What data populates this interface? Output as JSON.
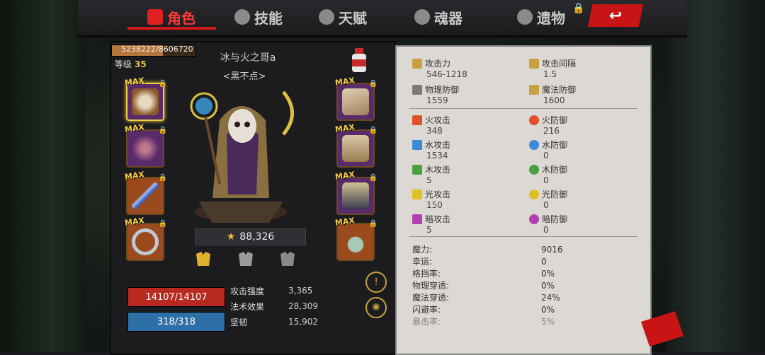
{
  "tabs": [
    {
      "label": "角色",
      "icon": "character-icon",
      "active": true
    },
    {
      "label": "技能",
      "icon": "skill-icon",
      "active": false
    },
    {
      "label": "天赋",
      "icon": "talent-icon",
      "active": false
    },
    {
      "label": "魂器",
      "icon": "soul-vessel-icon",
      "active": false
    },
    {
      "label": "遗物",
      "icon": "relic-icon",
      "active": false
    }
  ],
  "back_label": "↩",
  "exp": {
    "text": "5238222/8606720",
    "fraction": 0.61
  },
  "level": {
    "label": "等级",
    "value": "35"
  },
  "character": {
    "name": "冰与火之哥a",
    "title": "<黑不点>"
  },
  "power": {
    "value": "88,326"
  },
  "equipment": {
    "left": [
      {
        "name": "helmet",
        "max": "MAX",
        "color": "#5a2a6a"
      },
      {
        "name": "cloak",
        "max": "MAX",
        "color": "#5a2a6a"
      },
      {
        "name": "weapon",
        "max": "MAX",
        "color": "#9a4a1c"
      },
      {
        "name": "ring",
        "max": "MAX",
        "color": "#9a4a1c"
      }
    ],
    "right": [
      {
        "name": "shoulder",
        "max": "MAX",
        "color": "#5a2a6a"
      },
      {
        "name": "chest",
        "max": "MAX",
        "color": "#5a2a6a"
      },
      {
        "name": "boots",
        "max": "MAX",
        "color": "#5a2a6a"
      },
      {
        "name": "necklace",
        "max": "MAX",
        "color": "#9a4a1c"
      }
    ]
  },
  "hp": "14107/14107",
  "mp": "318/318",
  "sub_stats": [
    {
      "label": "攻击强度",
      "value": "3,365"
    },
    {
      "label": "法术效果",
      "value": "28,309"
    },
    {
      "label": "坚韧",
      "value": "15,902"
    }
  ],
  "stats_main": [
    {
      "label": "攻击力",
      "value": "546-1218",
      "color": "#c8a040"
    },
    {
      "label": "攻击间隔",
      "value": "1.5",
      "color": "#c8a040"
    },
    {
      "label": "物理防御",
      "value": "1559",
      "color": "#c8a040"
    },
    {
      "label": "魔法防御",
      "value": "1600",
      "color": "#c8a040"
    }
  ],
  "stats_element": [
    {
      "label": "火攻击",
      "value": "348",
      "color": "#e0502a"
    },
    {
      "label": "火防御",
      "value": "216",
      "color": "#e0502a"
    },
    {
      "label": "水攻击",
      "value": "1534",
      "color": "#3a8ad8"
    },
    {
      "label": "水防御",
      "value": "0",
      "color": "#3a8ad8"
    },
    {
      "label": "木攻击",
      "value": "5",
      "color": "#4aa040"
    },
    {
      "label": "木防御",
      "value": "0",
      "color": "#4aa040"
    },
    {
      "label": "光攻击",
      "value": "150",
      "color": "#e0c020"
    },
    {
      "label": "光防御",
      "value": "0",
      "color": "#e0c020"
    },
    {
      "label": "暗攻击",
      "value": "5",
      "color": "#b040b0"
    },
    {
      "label": "暗防御",
      "value": "0",
      "color": "#b040b0"
    }
  ],
  "stats_misc": [
    {
      "label": "魔力:",
      "value": "9016"
    },
    {
      "label": "幸运:",
      "value": "0"
    },
    {
      "label": "格挡率:",
      "value": "0%"
    },
    {
      "label": "物理穿透:",
      "value": "0%"
    },
    {
      "label": "魔法穿透:",
      "value": "24%"
    },
    {
      "label": "闪避率:",
      "value": "0%"
    },
    {
      "label": "暴击率:",
      "value": "5%"
    }
  ]
}
